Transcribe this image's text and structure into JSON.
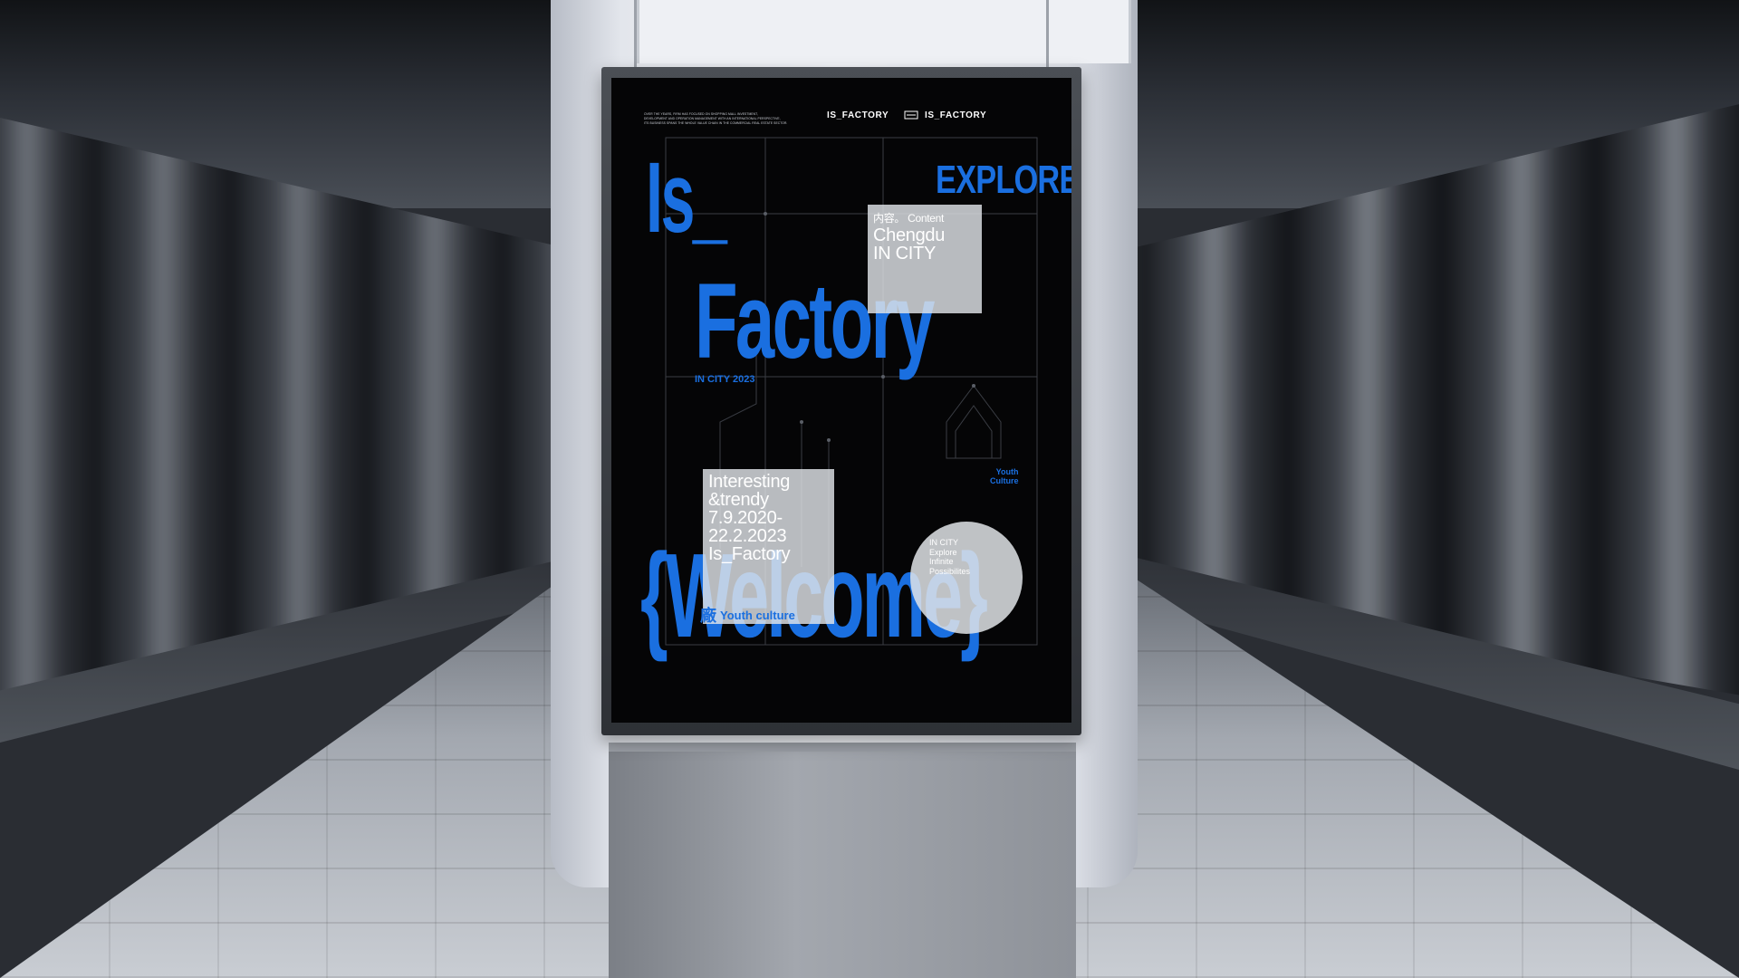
{
  "poster": {
    "intro_lines": [
      "OVER THE YEARS, FIRM HAS FOCUSED ON SHOPPING MALL INVESTMENT,",
      "DEVELOPMENT AND OPERATION MANAGEMENT WITH AN INTERNATIONAL PERSPECTIVE,",
      "ITS BUSINESS SPANS THE WHOLE VALUE CHAIN IN THE COMMERCIAL REAL ESTATE SECTOR."
    ],
    "brand_left": "IS_FACTORY",
    "brand_right": "IS_FACTORY",
    "explore": "EXPLORE",
    "title_line1": "Is_",
    "title_line2": "Factory",
    "subtitle": "IN CITY 2023",
    "box1": {
      "header": "内容。 Content",
      "line1": "Chengdu",
      "line2": "IN CITY"
    },
    "box2": {
      "line1": "Interesting",
      "line2": "&trendy",
      "line3": "7.9.2020-",
      "line4": "22.2.2023",
      "line5": "Is_Factory"
    },
    "youth_tag_cn": "廠",
    "youth_tag_en": "Youth culture",
    "youth_side_line1": "Youth",
    "youth_side_line2": "Culture",
    "welcome": "{Welcome}",
    "circle_lines": [
      "IN CITY",
      "Explore",
      "Infinite",
      "Possibilites"
    ]
  },
  "colors": {
    "accent": "#1a6fe0",
    "poster_bg": "#050506",
    "glass": "#e1e4e8"
  }
}
